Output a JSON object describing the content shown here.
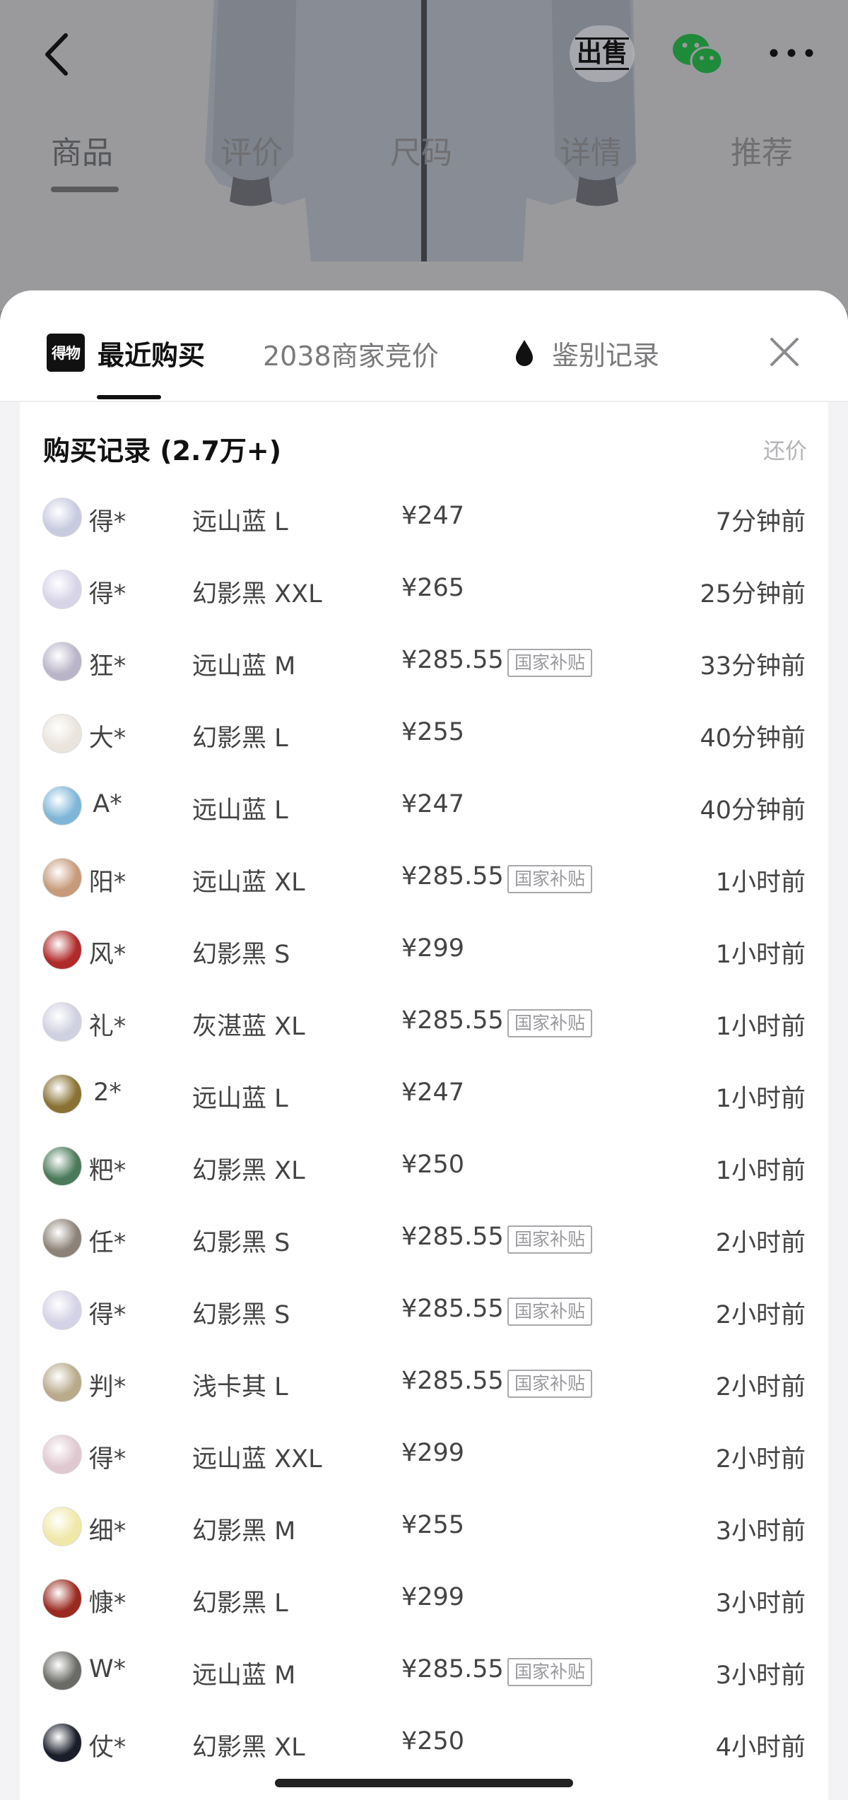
{
  "background": {
    "tabs": [
      {
        "label": "商品",
        "active": true
      },
      {
        "label": "评价",
        "active": false
      },
      {
        "label": "尺码",
        "active": false
      },
      {
        "label": "详情",
        "active": false
      },
      {
        "label": "推荐",
        "active": false
      }
    ],
    "sell_icon_text": "出售",
    "icons": [
      "back-icon",
      "sell-icon",
      "wechat-icon",
      "more-icon"
    ]
  },
  "sheet": {
    "tabs": {
      "recent": {
        "logo_text": "得物",
        "label": "最近购买"
      },
      "bids": {
        "label": "2038商家竞价"
      },
      "auth": {
        "label": "鉴别记录"
      }
    },
    "card": {
      "title": "购买记录 (2.7万+)",
      "action": "还价"
    },
    "rows": [
      {
        "user": "得*",
        "spec": "远山蓝 L",
        "price": "¥247",
        "badge": "",
        "time": "7分钟前",
        "avatar_color": "#c8cbe0"
      },
      {
        "user": "得*",
        "spec": "幻影黑 XXL",
        "price": "¥265",
        "badge": "",
        "time": "25分钟前",
        "avatar_color": "#d8d4e8"
      },
      {
        "user": "狂*",
        "spec": "远山蓝 M",
        "price": "¥285.55",
        "badge": "国家补贴",
        "time": "33分钟前",
        "avatar_color": "#b9b4c8"
      },
      {
        "user": "大*",
        "spec": "幻影黑 L",
        "price": "¥255",
        "badge": "",
        "time": "40分钟前",
        "avatar_color": "#e9e4dc"
      },
      {
        "user": "A*",
        "spec": "远山蓝 L",
        "price": "¥247",
        "badge": "",
        "time": "40分钟前",
        "avatar_color": "#7fb6d8"
      },
      {
        "user": "阳*",
        "spec": "远山蓝 XL",
        "price": "¥285.55",
        "badge": "国家补贴",
        "time": "1小时前",
        "avatar_color": "#c69a7a"
      },
      {
        "user": "风*",
        "spec": "幻影黑 S",
        "price": "¥299",
        "badge": "",
        "time": "1小时前",
        "avatar_color": "#b02a2a"
      },
      {
        "user": "礼*",
        "spec": "灰湛蓝 XL",
        "price": "¥285.55",
        "badge": "国家补贴",
        "time": "1小时前",
        "avatar_color": "#cfd0e0"
      },
      {
        "user": "2*",
        "spec": "远山蓝 L",
        "price": "¥247",
        "badge": "",
        "time": "1小时前",
        "avatar_color": "#8a7234"
      },
      {
        "user": "粑*",
        "spec": "幻影黑 XL",
        "price": "¥250",
        "badge": "",
        "time": "1小时前",
        "avatar_color": "#4a7a5a"
      },
      {
        "user": "任*",
        "spec": "幻影黑 S",
        "price": "¥285.55",
        "badge": "国家补贴",
        "time": "2小时前",
        "avatar_color": "#8c8278"
      },
      {
        "user": "得*",
        "spec": "幻影黑 S",
        "price": "¥285.55",
        "badge": "国家补贴",
        "time": "2小时前",
        "avatar_color": "#d4d2e6"
      },
      {
        "user": "判*",
        "spec": "浅卡其 L",
        "price": "¥285.55",
        "badge": "国家补贴",
        "time": "2小时前",
        "avatar_color": "#b8aa8a"
      },
      {
        "user": "得*",
        "spec": "远山蓝 XXL",
        "price": "¥299",
        "badge": "",
        "time": "2小时前",
        "avatar_color": "#e0c8d0"
      },
      {
        "user": "细*",
        "spec": "幻影黑 M",
        "price": "¥255",
        "badge": "",
        "time": "3小时前",
        "avatar_color": "#f0e8a8"
      },
      {
        "user": "慷*",
        "spec": "幻影黑 L",
        "price": "¥299",
        "badge": "",
        "time": "3小时前",
        "avatar_color": "#9a2a20"
      },
      {
        "user": "W*",
        "spec": "远山蓝 M",
        "price": "¥285.55",
        "badge": "国家补贴",
        "time": "3小时前",
        "avatar_color": "#6a6a66"
      },
      {
        "user": "仗*",
        "spec": "幻影黑 XL",
        "price": "¥250",
        "badge": "",
        "time": "4小时前",
        "avatar_color": "#1a1e2a"
      }
    ]
  },
  "colors": {
    "overlay_bg": "#878788",
    "sheet_bg": "#f3f3f5",
    "card_bg": "#ffffff",
    "accent": "#111111"
  }
}
